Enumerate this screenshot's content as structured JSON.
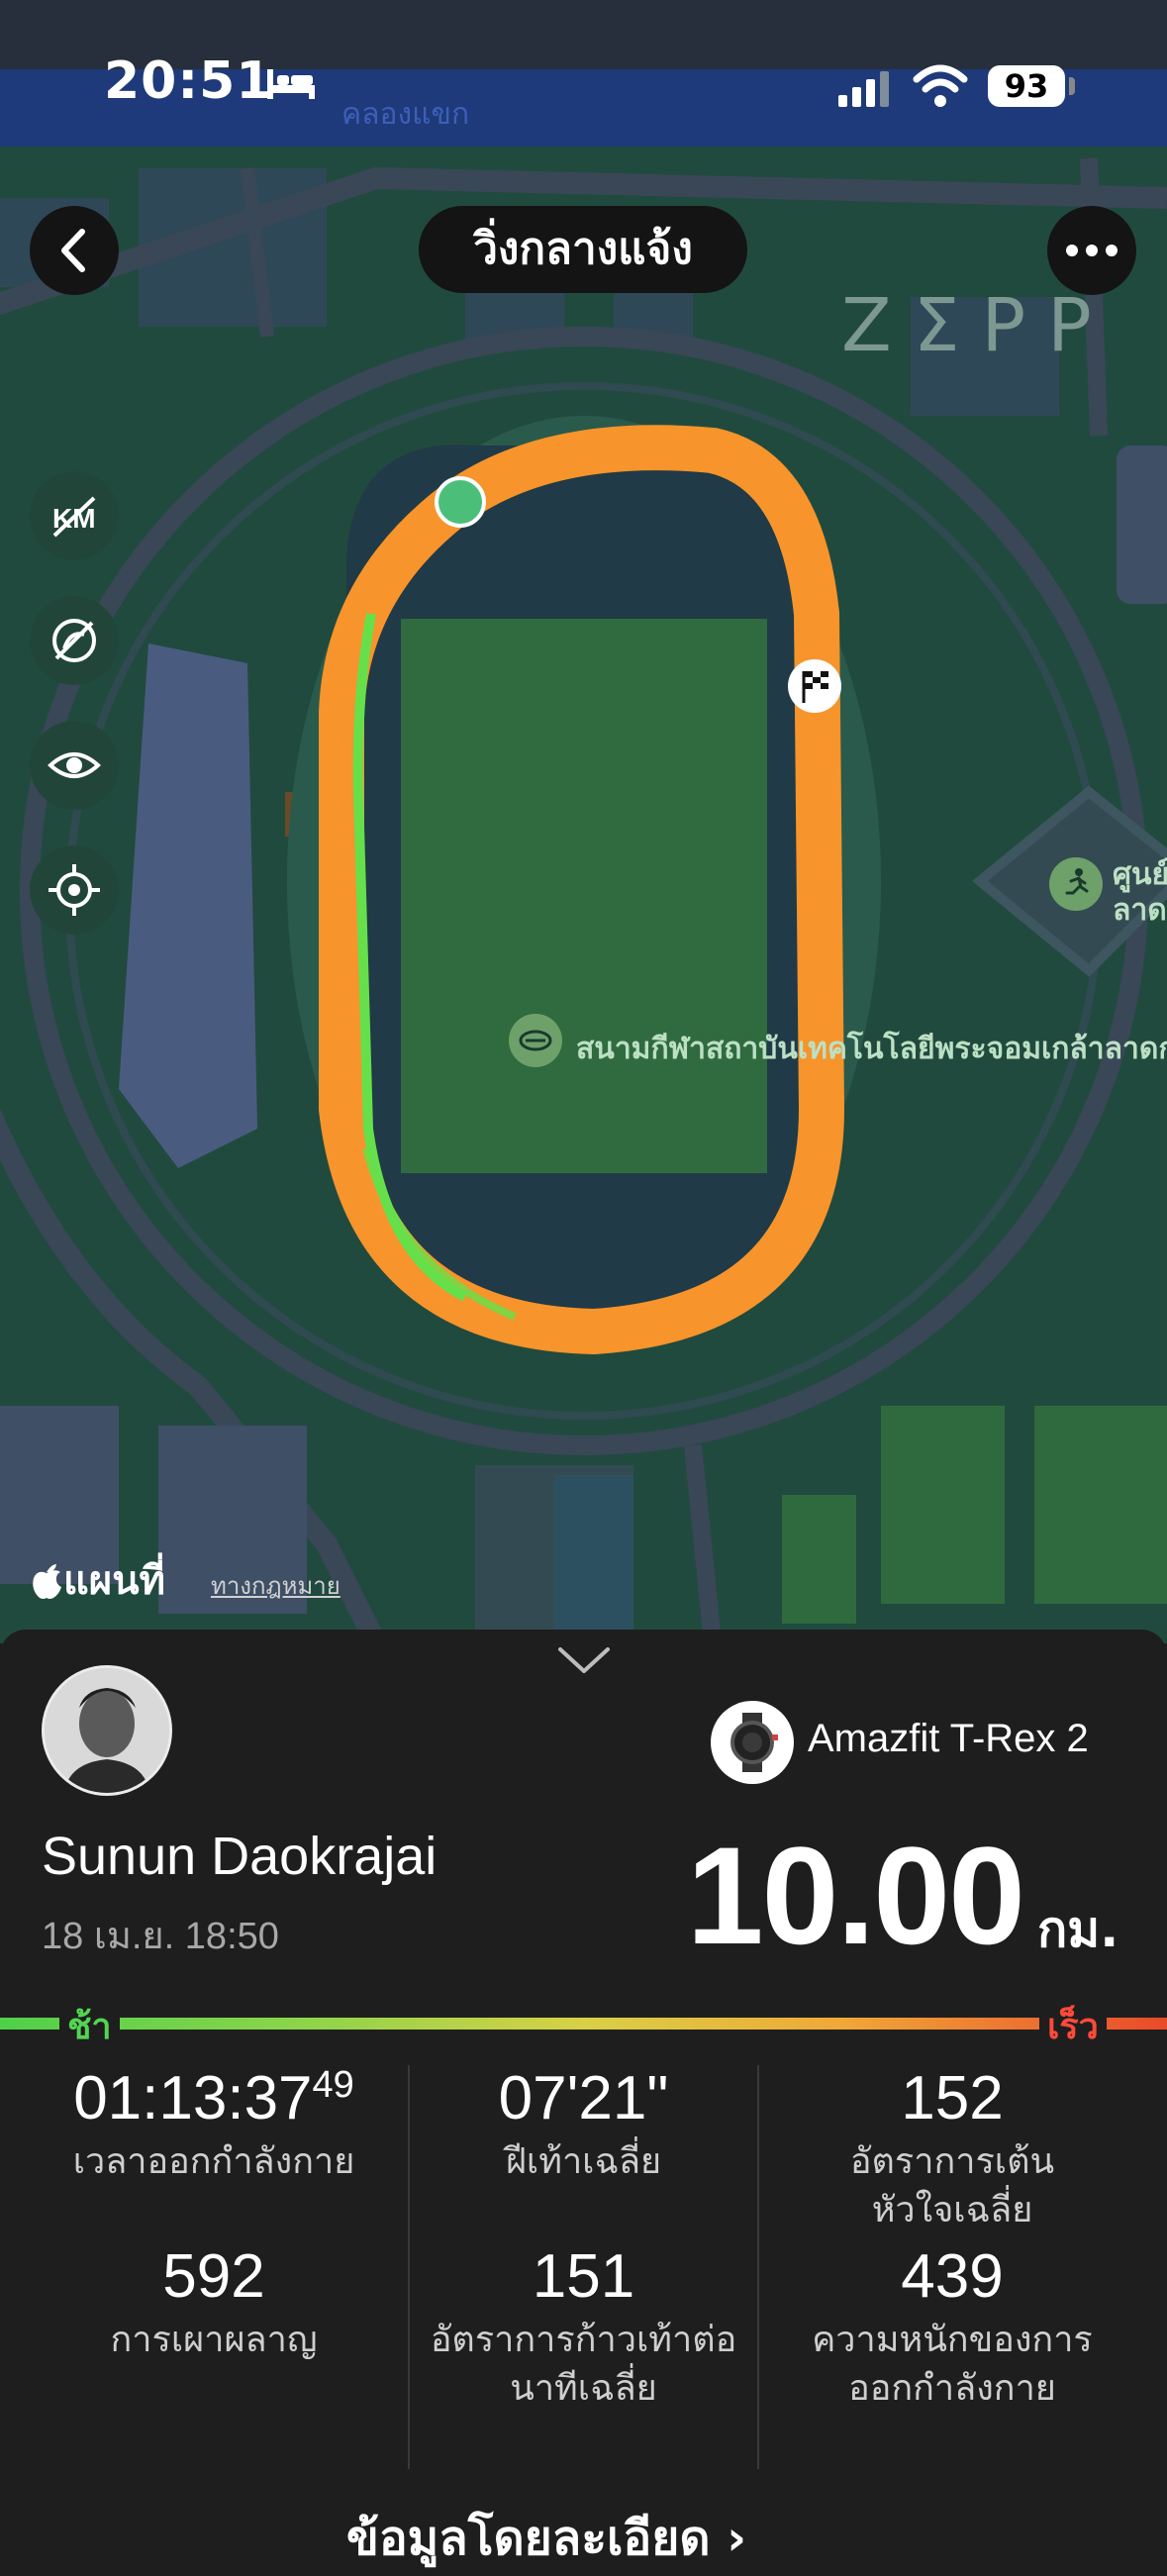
{
  "status_bar": {
    "time": "20:51",
    "battery": "93",
    "map_road_label": "คลองแขก"
  },
  "header": {
    "title": "วิ่งกลางแจ้ง",
    "brand": "ZΣPP"
  },
  "map": {
    "side_controls": [
      "km-marker-toggle",
      "hide-route-toggle",
      "visibility-toggle",
      "recenter"
    ],
    "poi_stadium": "สนามกีฬาสถาบันเทคโนโลยีพระจอมเกล้าลาดกระบัง",
    "poi_center_line1": "ศูนย์",
    "poi_center_line2": "ลาด",
    "attribution": "แผนที่",
    "legal": "ทางกฎหมาย",
    "route_color": "#f7942b",
    "route_fast_color": "#66e04a"
  },
  "workout": {
    "device": "Amazfit T-Rex 2",
    "user_name": "Sunun Daokrajai",
    "date": "18 เม.ย. 18:50",
    "distance": "10.00",
    "distance_unit": "กม.",
    "pace_slow_label": "ช้า",
    "pace_fast_label": "เร็ว"
  },
  "stats": {
    "duration_main": "01:13:37",
    "duration_fraction": "49",
    "duration_label": "เวลาออกกำลังกาย",
    "pace_value": "07'21\"",
    "pace_label": "ฝีเท้าเฉลี่ย",
    "hr_value": "152",
    "hr_label_line1": "อัตราการเต้น",
    "hr_label_line2": "หัวใจเฉลี่ย",
    "calories_value": "592",
    "calories_label": "การเผาผลาญ",
    "cadence_value": "151",
    "cadence_label_line1": "อัตราการก้าวเท้าต่อ",
    "cadence_label_line2": "นาทีเฉลี่ย",
    "load_value": "439",
    "load_label_line1": "ความหนักของการ",
    "load_label_line2": "ออกกำลังกาย"
  },
  "footer": {
    "details_link": "ข้อมูลโดยละเอียด"
  }
}
